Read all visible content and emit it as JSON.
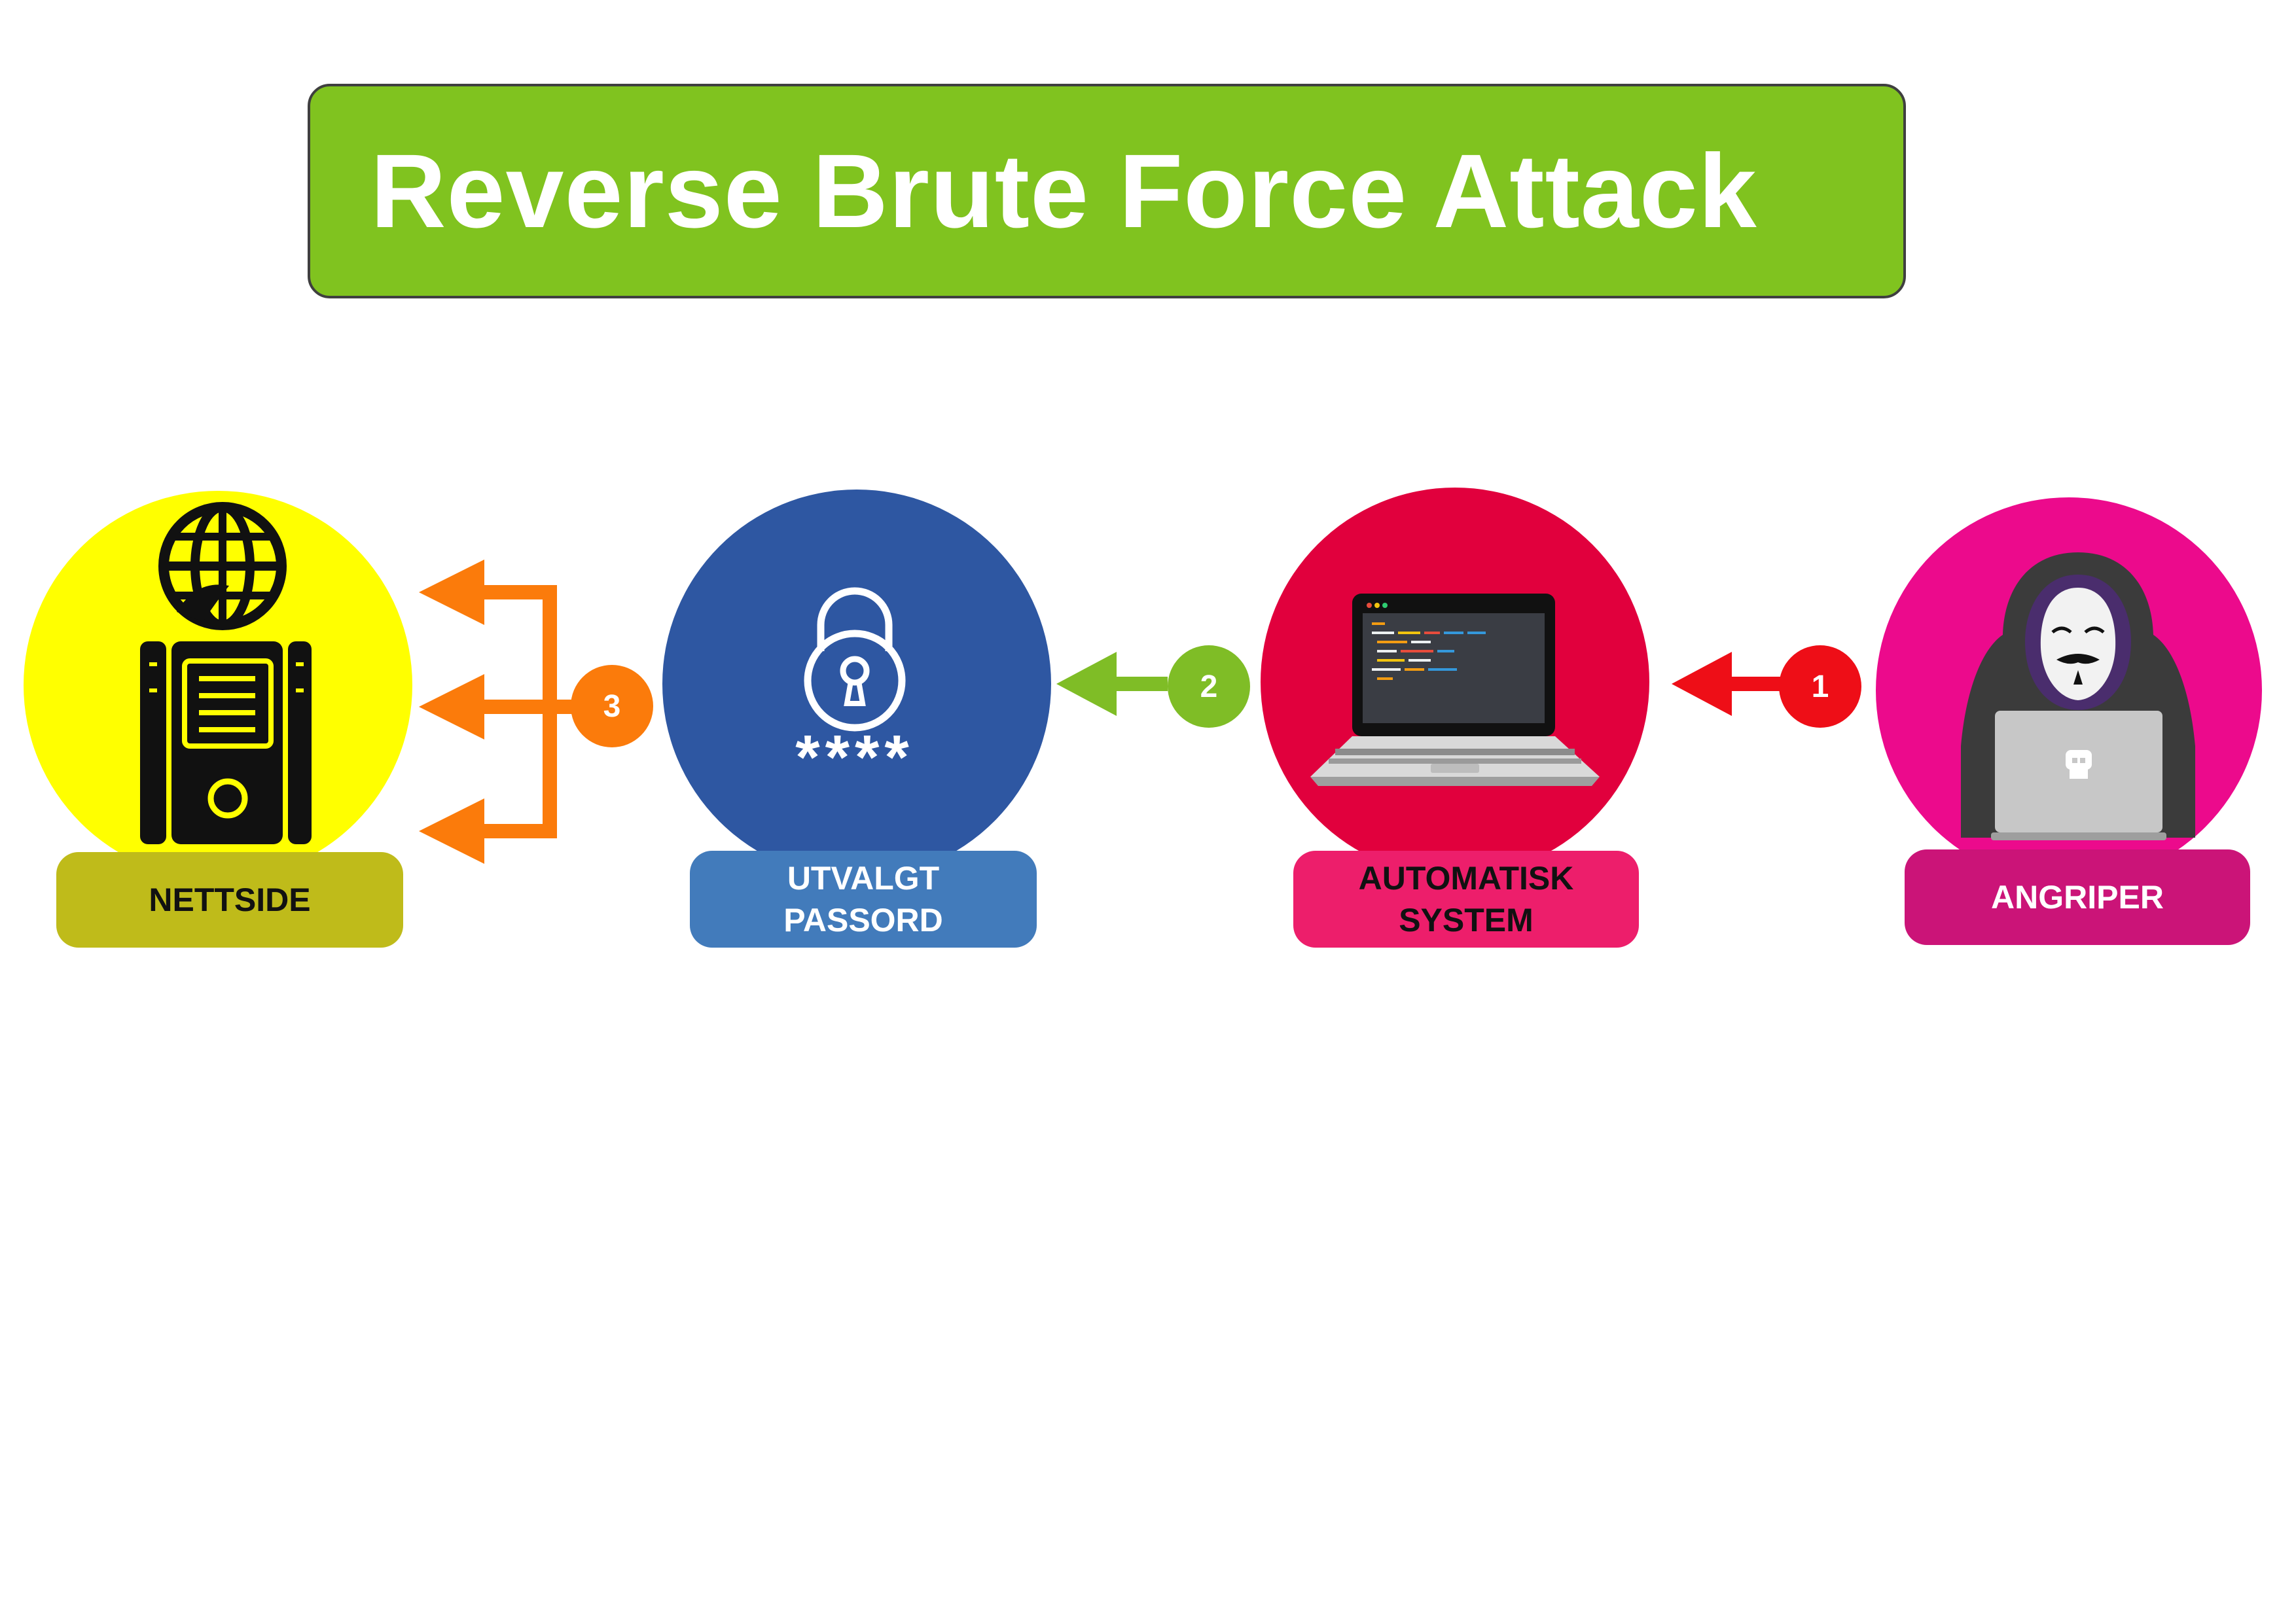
{
  "title": "Reverse Brute Force Attack",
  "nodes": {
    "website": {
      "label": "NETTSIDE",
      "circle_color": "#ffff00",
      "label_bg": "#bfbb1a",
      "label_color": "#111111",
      "icon": "web-server-icon"
    },
    "password": {
      "label": "UTVALGT\nPASSORD",
      "circle_color": "#2e57a2",
      "label_bg": "#427bbb",
      "label_color": "#ffffff",
      "icon": "padlock-icon",
      "masked_text": "****"
    },
    "system": {
      "label": "AUTOMATISK\nSYSTEM",
      "circle_color": "#e1003d",
      "label_bg": "#ed1e6b",
      "label_color": "#111111",
      "icon": "laptop-icon"
    },
    "attacker": {
      "label": "ANGRIPER",
      "circle_color": "#ec0a8c",
      "label_bg": "#cb1478",
      "label_color": "#ffffff",
      "icon": "hacker-icon"
    }
  },
  "steps": [
    {
      "number": "1",
      "color": "#ee0e17"
    },
    {
      "number": "2",
      "color": "#7fbd26"
    },
    {
      "number": "3",
      "color": "#fb7b0b"
    }
  ],
  "colors": {
    "title_bg": "#80c31f",
    "title_text": "#ffffff"
  }
}
